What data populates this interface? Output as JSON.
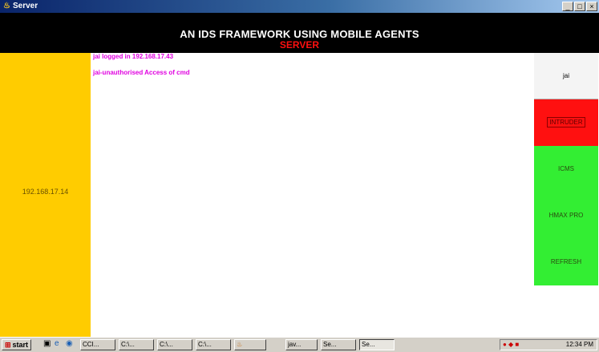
{
  "window": {
    "title": "Server",
    "controls": [
      "_",
      "□",
      "×"
    ]
  },
  "banner": {
    "heading": "AN IDS FRAMEWORK USING MOBILE AGENTS",
    "subheading": "SERVER"
  },
  "left_panel": {
    "ip": "192.168.17.14"
  },
  "log": [
    "jai logged in 192.168.17.43",
    "jai-unauthorised Access of cmd"
  ],
  "right_panel": {
    "user": "jai",
    "buttons": [
      "INTRUDER",
      "ICMS",
      "HMAX PRO",
      "REFRESH"
    ]
  },
  "colors": {
    "banner_bg": "#000000",
    "left_panel_bg": "#ffcc00",
    "log_text": "#e000e0",
    "alert_button": "#ff1010",
    "action_button": "#33ee33"
  },
  "taskbar": {
    "start_label": "start",
    "items": [
      "CCI...",
      "C:\\...",
      "C:\\...",
      "C:\\...",
      "",
      "jav...",
      "Se...",
      "Se..."
    ],
    "clock": "12:34 PM"
  }
}
